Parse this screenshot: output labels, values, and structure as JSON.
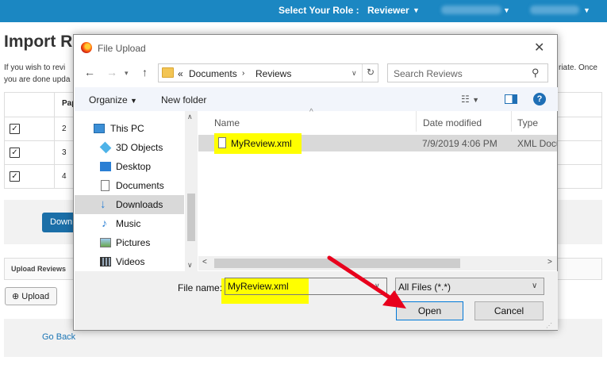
{
  "topbar": {
    "role_label": "Select Your Role :",
    "role_value": "Reviewer"
  },
  "page": {
    "title": "Import Re",
    "desc_left": "If you wish to revi you are done upda",
    "desc_right": "riate. Once",
    "table": {
      "header": "Pap",
      "rows": [
        "2",
        "3",
        "4"
      ]
    },
    "download_btn": "Down",
    "upload_header": "Upload Reviews",
    "upload_btn": "Upload",
    "go_back": "Go Back"
  },
  "dialog": {
    "title": "File Upload",
    "address": {
      "prefix": "«",
      "path": [
        "Documents",
        "Reviews"
      ]
    },
    "search_placeholder": "Search Reviews",
    "toolbar": {
      "organize": "Organize",
      "new_folder": "New folder"
    },
    "nav_items": [
      {
        "label": "This PC",
        "icon": "this-pc-icon"
      },
      {
        "label": "3D Objects",
        "icon": "3d-objects-icon"
      },
      {
        "label": "Desktop",
        "icon": "desktop-icon"
      },
      {
        "label": "Documents",
        "icon": "documents-icon"
      },
      {
        "label": "Downloads",
        "icon": "downloads-icon",
        "selected": true
      },
      {
        "label": "Music",
        "icon": "music-icon"
      },
      {
        "label": "Pictures",
        "icon": "pictures-icon"
      },
      {
        "label": "Videos",
        "icon": "videos-icon"
      }
    ],
    "columns": [
      "Name",
      "Date modified",
      "Type"
    ],
    "files": [
      {
        "name": "MyReview.xml",
        "date": "7/9/2019 4:06 PM",
        "type": "XML Document"
      }
    ],
    "file_name_label": "File name:",
    "file_name_value": "MyReview.xml",
    "filter": "All Files (*.*)",
    "open_btn": "Open",
    "cancel_btn": "Cancel"
  },
  "colors": {
    "topbar": "#1b87c2",
    "highlight": "#ffff00",
    "arrow": "#e8001c"
  }
}
